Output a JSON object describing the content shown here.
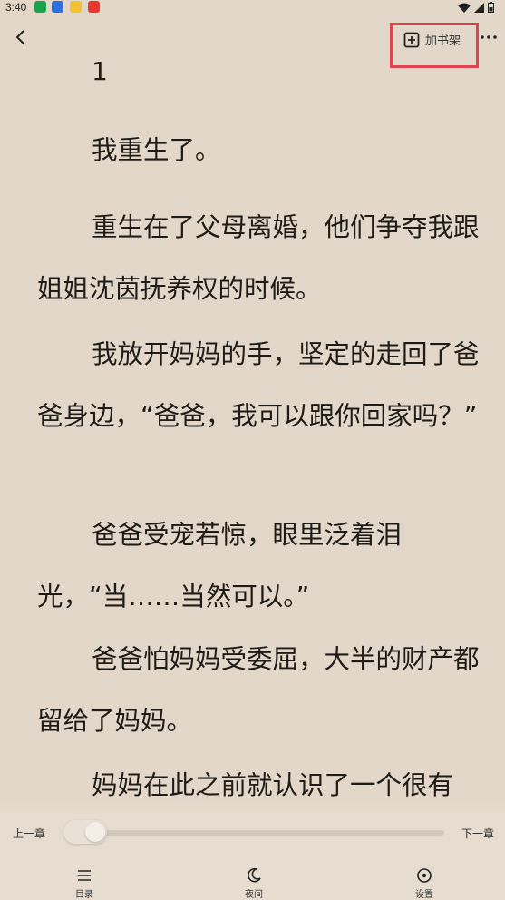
{
  "status_bar": {
    "time": "3:40",
    "app_icons": [
      "green-app-icon",
      "blue-phone-icon",
      "yellow-app-icon",
      "red-app-icon"
    ],
    "right_icons": [
      "wifi-icon",
      "signal-icon",
      "battery-icon"
    ]
  },
  "toolbar": {
    "back_icon": "chevron-left-icon",
    "add_shelf_label": "加书架",
    "add_shelf_icon": "add-box-icon",
    "more_icon": "more-dots-icon",
    "highlight_color": "#e0434e"
  },
  "reader": {
    "chapter_number": "1",
    "paragraphs": [
      "我重生了。",
      "重生在了父母离婚，他们争夺我跟姐姐沈茵抚养权的时候。",
      "我放开妈妈的手，坚定的走回了爸爸身边，“爸爸，我可以跟你回家吗？”",
      "爸爸受宠若惊，眼里泛着泪光，“当……当然可以。”",
      "爸爸怕妈妈受委屈，大半的财产都留给了妈妈。",
      "妈妈在此之前就认识了一个很有"
    ],
    "background_color": "#e2d7c8"
  },
  "bottom_bar": {
    "prev_chapter": "上一章",
    "next_chapter": "下一章",
    "progress": 0.0,
    "nav": [
      {
        "label": "目录",
        "icon": "list-icon"
      },
      {
        "label": "夜间",
        "icon": "moon-icon"
      },
      {
        "label": "设置",
        "icon": "settings-icon"
      }
    ]
  }
}
